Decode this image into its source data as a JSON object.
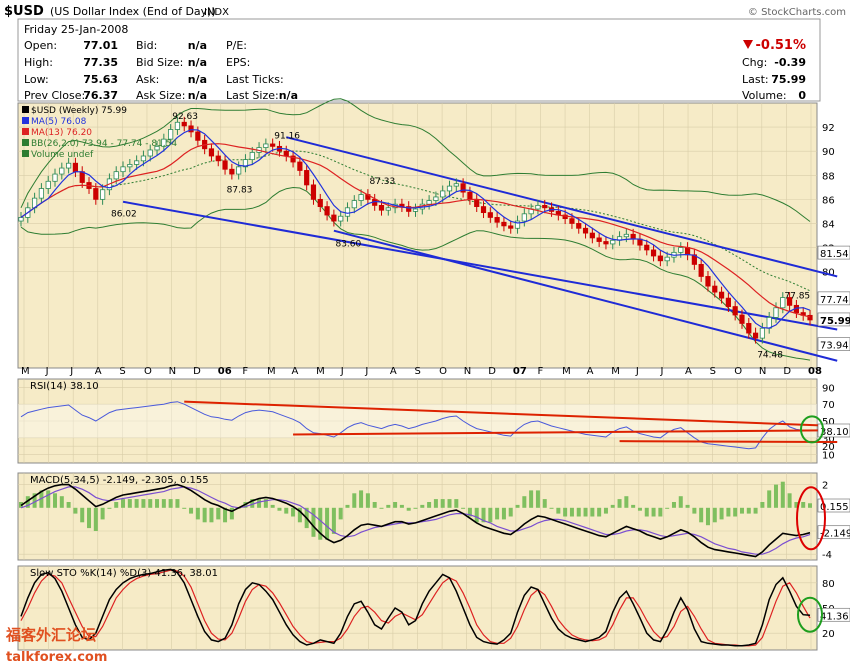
{
  "header": {
    "symbol": "$USD",
    "name": "(US Dollar Index (End of Day))",
    "exchange": "INDX",
    "credit": "© StockCharts.com",
    "date_line": "Friday  25-Jan-2008",
    "quote_labels": [
      "Open:",
      "High:",
      "Low:",
      "Prev Close:"
    ],
    "quote_values": [
      "77.01",
      "77.35",
      "75.63",
      "76.37"
    ],
    "bid_labels": [
      "Bid:",
      "Bid Size:",
      "Ask:",
      "Ask Size:"
    ],
    "bid_values": [
      "n/a",
      "n/a",
      "n/a",
      "n/a"
    ],
    "pe_labels": [
      "P/E:",
      "EPS:",
      "Last Ticks:",
      "Last Size:"
    ],
    "pe_values": [
      "",
      "",
      "",
      "n/a"
    ],
    "change_pct": "-0.51%",
    "stat_labels": [
      "Chg:",
      "Last:",
      "Volume:"
    ],
    "stat_values": [
      "-0.39",
      "75.99",
      "0"
    ]
  },
  "colors": {
    "panel_bg": "#f6ebc7",
    "up_candle": "#2e8b57",
    "down_candle": "#cc0000",
    "ma5": "#2233dd",
    "ma13": "#dd2222",
    "bollinger": "#2e7d32",
    "channel": "#1f2bd6",
    "rsi_line": "#4a5adb",
    "rsi_trend": "#dd2200",
    "macd_line": "#000000",
    "macd_signal": "#7b4fd1",
    "histogram": "#7fbf5f",
    "sto_k": "#000000",
    "sto_d": "#dd2222",
    "circle_green": "#1e9e1e",
    "circle_red": "#dd0000"
  },
  "watermark": {
    "chinese": "福客外汇论坛",
    "site": "talkforex.com"
  },
  "chart_data": [
    {
      "type": "candlestick",
      "title": "$USD (Weekly) 75.99",
      "legend": [
        {
          "name": "$USD (Weekly) 75.99"
        },
        {
          "name": "MA(5) 76.08"
        },
        {
          "name": "MA(13) 76.20"
        },
        {
          "name": "BB(26,2.0) 73.94 - 77.74 - 81.54"
        },
        {
          "name": "Volume undef"
        }
      ],
      "x_ticks": [
        "M",
        "J",
        "J",
        "A",
        "S",
        "O",
        "N",
        "D",
        "06",
        "F",
        "M",
        "A",
        "M",
        "J",
        "J",
        "A",
        "S",
        "O",
        "N",
        "D",
        "07",
        "F",
        "M",
        "A",
        "M",
        "J",
        "J",
        "A",
        "S",
        "O",
        "N",
        "D",
        "08"
      ],
      "ylim": [
        72,
        94
      ],
      "y_ticks": [
        80,
        82,
        84,
        86,
        88,
        90,
        92
      ],
      "closes": [
        84.5,
        85.3,
        86.1,
        86.9,
        87.5,
        88.1,
        88.6,
        89.0,
        88.3,
        87.4,
        86.9,
        86.0,
        86.8,
        87.7,
        88.3,
        88.7,
        88.9,
        89.2,
        89.6,
        90.1,
        90.4,
        91.0,
        91.8,
        92.4,
        92.1,
        91.6,
        90.9,
        90.2,
        89.6,
        89.2,
        88.5,
        88.1,
        88.7,
        89.3,
        89.9,
        90.3,
        90.6,
        90.4,
        90.0,
        89.6,
        89.1,
        88.4,
        87.2,
        86.0,
        85.4,
        84.7,
        84.2,
        84.6,
        85.3,
        85.9,
        86.4,
        86.0,
        85.5,
        85.1,
        85.3,
        85.6,
        85.4,
        85.0,
        85.2,
        85.6,
        85.9,
        86.2,
        86.7,
        87.1,
        87.3,
        86.6,
        86.0,
        85.4,
        84.9,
        84.5,
        84.1,
        83.8,
        83.6,
        84.2,
        84.8,
        85.2,
        85.5,
        85.3,
        85.0,
        84.7,
        84.4,
        84.0,
        83.6,
        83.2,
        82.8,
        82.5,
        82.3,
        82.6,
        82.9,
        83.1,
        82.7,
        82.2,
        81.8,
        81.3,
        80.9,
        81.2,
        81.6,
        82.0,
        81.4,
        80.6,
        79.6,
        78.8,
        78.3,
        77.8,
        77.1,
        76.4,
        75.7,
        74.9,
        74.48,
        75.3,
        76.2,
        77.0,
        77.85,
        77.2,
        76.6,
        76.37,
        75.99
      ],
      "labels": [
        {
          "text": "92.63",
          "x_week": 24,
          "y": 93.0
        },
        {
          "text": "91.16",
          "x_week": 39,
          "y": 91.4
        },
        {
          "text": "87.83",
          "x_week": 32,
          "y": 86.9
        },
        {
          "text": "86.02",
          "x_week": 15,
          "y": 84.9
        },
        {
          "text": "87.33",
          "x_week": 53,
          "y": 87.6
        },
        {
          "text": "83.60",
          "x_week": 48,
          "y": 82.4
        },
        {
          "text": "77.85",
          "x_week": 114,
          "y": 78.1
        },
        {
          "text": "74.48",
          "x_week": 110,
          "y": 73.2
        }
      ],
      "right_labels": [
        {
          "text": "81.54",
          "value": 81.54
        },
        {
          "text": "77.74",
          "value": 77.74
        },
        {
          "text": "75.99",
          "value": 75.99
        },
        {
          "text": "73.94",
          "value": 73.94
        }
      ]
    },
    {
      "type": "line",
      "title": "RSI(14) 38.10",
      "ylim": [
        0,
        100
      ],
      "y_ticks": [
        10,
        20,
        30,
        50,
        70,
        90
      ],
      "right_labels": [
        {
          "text": "38.10",
          "value": 38.1
        }
      ],
      "series": [
        {
          "name": "RSI(14)",
          "values": [
            55,
            60,
            62,
            64,
            66,
            67,
            68,
            69,
            63,
            57,
            54,
            50,
            55,
            60,
            63,
            64,
            65,
            66,
            67,
            68,
            69,
            70,
            72,
            73,
            70,
            66,
            62,
            58,
            55,
            54,
            52,
            51,
            56,
            60,
            62,
            63,
            62,
            61,
            58,
            55,
            52,
            48,
            41,
            36,
            35,
            33,
            31,
            36,
            42,
            46,
            48,
            45,
            43,
            41,
            44,
            46,
            44,
            41,
            43,
            46,
            48,
            50,
            53,
            55,
            56,
            50,
            45,
            41,
            39,
            37,
            35,
            33,
            32,
            40,
            46,
            49,
            50,
            47,
            44,
            42,
            40,
            38,
            36,
            34,
            33,
            32,
            31,
            37,
            41,
            43,
            38,
            35,
            33,
            31,
            30,
            36,
            40,
            42,
            36,
            30,
            25,
            23,
            22,
            21,
            20,
            19,
            18,
            17,
            18,
            30,
            40,
            46,
            50,
            43,
            40,
            39,
            38.1
          ]
        }
      ]
    },
    {
      "type": "line",
      "title": "MACD(5,34,5) -2.149, -2.305, 0.155",
      "ylim": [
        -4.5,
        3
      ],
      "y_ticks": [
        2,
        -2,
        -4
      ],
      "right_labels": [
        {
          "text": "0.155",
          "value": 0.155
        },
        {
          "text": "-2.149",
          "value": -2.149
        }
      ],
      "series": [
        {
          "name": "MACD",
          "values": [
            0.2,
            0.6,
            1.0,
            1.4,
            1.7,
            1.9,
            2.0,
            2.0,
            1.6,
            1.1,
            0.6,
            0.1,
            0.3,
            0.6,
            0.9,
            1.1,
            1.2,
            1.3,
            1.4,
            1.5,
            1.6,
            1.7,
            1.9,
            2.0,
            1.8,
            1.5,
            1.1,
            0.7,
            0.4,
            0.2,
            -0.1,
            -0.3,
            0.0,
            0.3,
            0.6,
            0.8,
            0.9,
            0.8,
            0.6,
            0.4,
            0.1,
            -0.3,
            -0.9,
            -1.6,
            -2.2,
            -2.7,
            -3.0,
            -2.8,
            -2.4,
            -1.9,
            -1.5,
            -1.4,
            -1.5,
            -1.6,
            -1.4,
            -1.2,
            -1.2,
            -1.4,
            -1.3,
            -1.1,
            -0.9,
            -0.7,
            -0.5,
            -0.3,
            -0.2,
            -0.5,
            -0.9,
            -1.3,
            -1.6,
            -1.8,
            -2.0,
            -2.2,
            -2.3,
            -1.9,
            -1.4,
            -1.0,
            -0.7,
            -0.8,
            -1.0,
            -1.2,
            -1.4,
            -1.6,
            -1.8,
            -2.0,
            -2.2,
            -2.4,
            -2.5,
            -2.2,
            -1.9,
            -1.6,
            -1.8,
            -2.0,
            -2.3,
            -2.5,
            -2.7,
            -2.5,
            -2.2,
            -1.9,
            -2.1,
            -2.5,
            -3.0,
            -3.4,
            -3.6,
            -3.7,
            -3.8,
            -3.9,
            -4.0,
            -4.1,
            -4.2,
            -3.8,
            -3.2,
            -2.7,
            -2.2,
            -2.3,
            -2.4,
            -2.3,
            -2.149
          ]
        },
        {
          "name": "Signal",
          "values": [
            0.0,
            0.2,
            0.5,
            0.8,
            1.1,
            1.4,
            1.6,
            1.8,
            1.8,
            1.6,
            1.3,
            0.9,
            0.7,
            0.6,
            0.7,
            0.8,
            0.9,
            1.0,
            1.1,
            1.2,
            1.3,
            1.4,
            1.6,
            1.7,
            1.8,
            1.7,
            1.5,
            1.2,
            0.9,
            0.6,
            0.4,
            0.1,
            0.0,
            0.1,
            0.3,
            0.5,
            0.6,
            0.7,
            0.7,
            0.6,
            0.4,
            0.2,
            -0.2,
            -0.6,
            -1.1,
            -1.6,
            -2.1,
            -2.4,
            -2.5,
            -2.4,
            -2.1,
            -1.9,
            -1.7,
            -1.6,
            -1.5,
            -1.4,
            -1.3,
            -1.3,
            -1.3,
            -1.2,
            -1.1,
            -1.0,
            -0.8,
            -0.6,
            -0.5,
            -0.5,
            -0.6,
            -0.8,
            -1.1,
            -1.3,
            -1.6,
            -1.8,
            -2.0,
            -2.0,
            -1.8,
            -1.6,
            -1.3,
            -1.1,
            -1.0,
            -1.0,
            -1.1,
            -1.3,
            -1.5,
            -1.7,
            -1.9,
            -2.1,
            -2.3,
            -2.3,
            -2.2,
            -2.0,
            -1.9,
            -1.9,
            -2.0,
            -2.2,
            -2.4,
            -2.5,
            -2.4,
            -2.3,
            -2.2,
            -2.3,
            -2.5,
            -2.8,
            -3.1,
            -3.3,
            -3.5,
            -3.6,
            -3.8,
            -3.9,
            -4.0,
            -4.0,
            -3.8,
            -3.5,
            -3.1,
            -2.8,
            -2.6,
            -2.5,
            -2.305
          ]
        }
      ]
    },
    {
      "type": "line",
      "title": "Slow STO %K(14) %D(3) 41.36, 38.01",
      "ylim": [
        0,
        100
      ],
      "y_ticks": [
        20,
        50,
        80
      ],
      "right_labels": [
        {
          "text": "41.36",
          "value": 41.36
        }
      ],
      "series": [
        {
          "name": "%K",
          "values": [
            40,
            62,
            80,
            90,
            92,
            85,
            70,
            50,
            30,
            15,
            12,
            20,
            40,
            60,
            72,
            80,
            85,
            88,
            90,
            91,
            93,
            95,
            96,
            92,
            80,
            60,
            40,
            22,
            12,
            10,
            14,
            30,
            55,
            72,
            80,
            78,
            70,
            60,
            45,
            30,
            18,
            10,
            6,
            8,
            12,
            10,
            8,
            20,
            40,
            55,
            58,
            45,
            30,
            25,
            38,
            50,
            45,
            30,
            35,
            55,
            70,
            80,
            90,
            86,
            70,
            50,
            30,
            15,
            10,
            8,
            7,
            12,
            20,
            45,
            65,
            75,
            72,
            55,
            38,
            25,
            18,
            14,
            12,
            10,
            12,
            15,
            22,
            45,
            62,
            70,
            55,
            38,
            20,
            12,
            10,
            24,
            45,
            62,
            48,
            25,
            10,
            8,
            7,
            6,
            6,
            5,
            5,
            6,
            8,
            30,
            60,
            78,
            86,
            70,
            52,
            42,
            41.36
          ]
        },
        {
          "name": "%D",
          "values": [
            35,
            50,
            68,
            82,
            90,
            88,
            80,
            62,
            45,
            28,
            16,
            16,
            28,
            45,
            62,
            72,
            80,
            85,
            88,
            90,
            91,
            93,
            95,
            94,
            88,
            75,
            55,
            35,
            20,
            13,
            12,
            20,
            38,
            58,
            72,
            78,
            76,
            68,
            56,
            42,
            28,
            18,
            10,
            8,
            9,
            10,
            10,
            14,
            25,
            40,
            50,
            52,
            45,
            35,
            32,
            40,
            44,
            40,
            36,
            42,
            55,
            68,
            80,
            86,
            82,
            68,
            50,
            30,
            18,
            10,
            8,
            8,
            14,
            28,
            48,
            65,
            72,
            66,
            52,
            36,
            26,
            18,
            14,
            12,
            11,
            12,
            16,
            30,
            48,
            62,
            62,
            50,
            35,
            22,
            14,
            16,
            28,
            46,
            52,
            40,
            25,
            12,
            8,
            7,
            6,
            6,
            5,
            5,
            6,
            15,
            36,
            58,
            76,
            80,
            68,
            52,
            38.01
          ]
        }
      ]
    }
  ]
}
